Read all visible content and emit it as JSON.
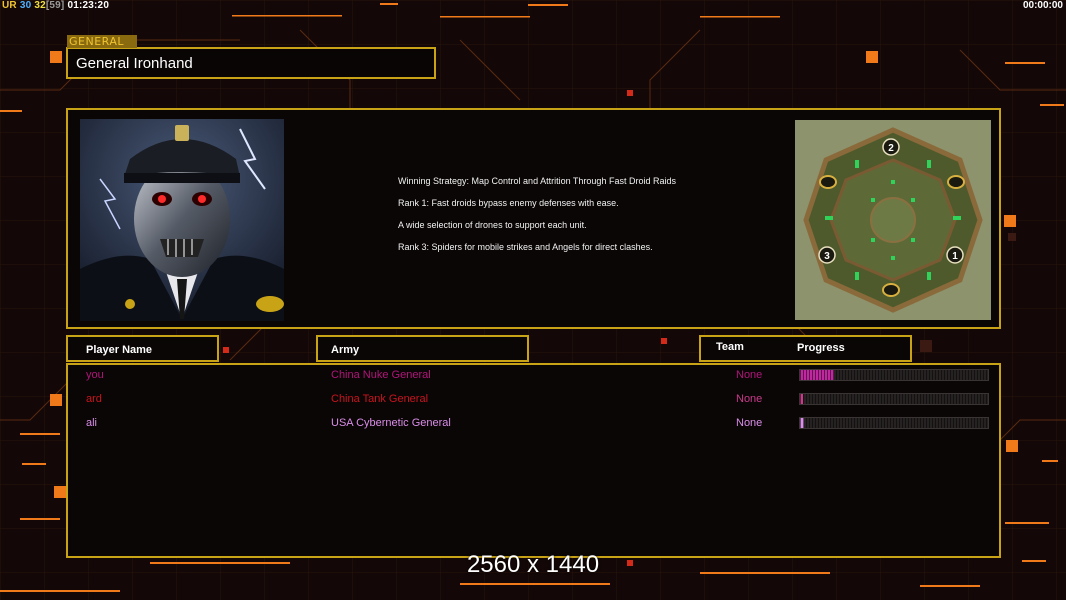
{
  "hud": {
    "ur_label": "UR",
    "value_a": "30",
    "value_b": "32",
    "bracket_value": "[59]",
    "clock": "01:23:20",
    "timer": "00:00:00"
  },
  "general": {
    "tab_label": "GENERAL",
    "name": "General Ironhand",
    "portrait_icon": "cyborg-general-portrait",
    "strategy_lines": [
      "Winning Strategy: Map Control and Attrition Through Fast Droid Raids",
      "Rank 1: Fast droids bypass enemy defenses with ease.",
      "A wide selection of drones to support each unit.",
      "Rank 3: Spiders for mobile strikes and Angels for direct clashes."
    ]
  },
  "minimap": {
    "icon": "minimap",
    "start_positions": [
      "2",
      "3",
      "1"
    ]
  },
  "columns": {
    "player_name": "Player Name",
    "army": "Army",
    "team": "Team",
    "progress": "Progress"
  },
  "players": [
    {
      "name": "you",
      "army": "China Nuke General",
      "team": "None",
      "progress": 0.18,
      "name_color": "#b0157a",
      "army_color": "#b0157a",
      "team_color": "#b0157a",
      "bar_color": "#c028a0"
    },
    {
      "name": "ard",
      "army": "China Tank General",
      "team": "None",
      "progress": 0.01,
      "name_color": "#c8141e",
      "army_color": "#c8141e",
      "team_color": "#c93a8a",
      "bar_color": "#c93a8a"
    },
    {
      "name": "ali",
      "army": "USA Cybernetic General",
      "team": "None",
      "progress": 0.02,
      "name_color": "#d98ee8",
      "army_color": "#d98ee8",
      "team_color": "#d98ee8",
      "bar_color": "#d98ee8"
    }
  ],
  "resolution": "2560 x 1440",
  "colors": {
    "frame_gold": "#c9a316",
    "accent_orange": "#f07a1a"
  }
}
